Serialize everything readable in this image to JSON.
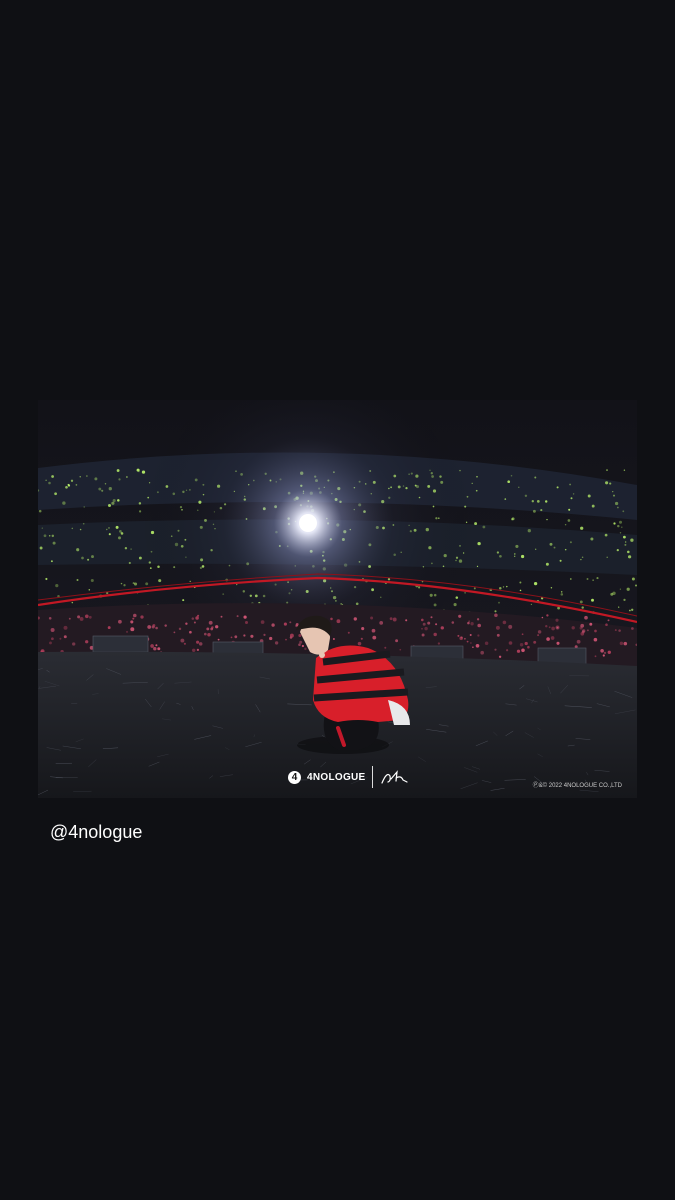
{
  "post": {
    "credit_handle": "@4nologue"
  },
  "photo": {
    "watermark_brand": "4NOLOGUE",
    "watermark_brand_icon": "4",
    "copyright": "Ⓟ&© 2022 4NOLOGUE CO.,LTD",
    "colors": {
      "page_background": "#0f1014",
      "shirt_red": "#d81f2a",
      "lightstick_green": "#b8f06a",
      "stage_light": "#ffffff"
    }
  }
}
